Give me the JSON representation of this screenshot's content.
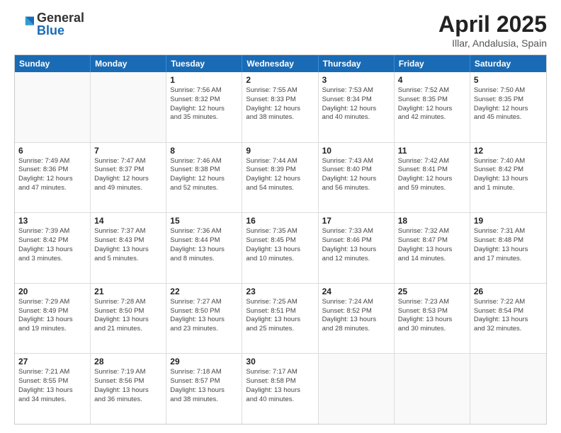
{
  "logo": {
    "general": "General",
    "blue": "Blue"
  },
  "title": {
    "month": "April 2025",
    "location": "Illar, Andalusia, Spain"
  },
  "header_days": [
    "Sunday",
    "Monday",
    "Tuesday",
    "Wednesday",
    "Thursday",
    "Friday",
    "Saturday"
  ],
  "weeks": [
    [
      {
        "day": "",
        "lines": []
      },
      {
        "day": "",
        "lines": []
      },
      {
        "day": "1",
        "lines": [
          "Sunrise: 7:56 AM",
          "Sunset: 8:32 PM",
          "Daylight: 12 hours",
          "and 35 minutes."
        ]
      },
      {
        "day": "2",
        "lines": [
          "Sunrise: 7:55 AM",
          "Sunset: 8:33 PM",
          "Daylight: 12 hours",
          "and 38 minutes."
        ]
      },
      {
        "day": "3",
        "lines": [
          "Sunrise: 7:53 AM",
          "Sunset: 8:34 PM",
          "Daylight: 12 hours",
          "and 40 minutes."
        ]
      },
      {
        "day": "4",
        "lines": [
          "Sunrise: 7:52 AM",
          "Sunset: 8:35 PM",
          "Daylight: 12 hours",
          "and 42 minutes."
        ]
      },
      {
        "day": "5",
        "lines": [
          "Sunrise: 7:50 AM",
          "Sunset: 8:35 PM",
          "Daylight: 12 hours",
          "and 45 minutes."
        ]
      }
    ],
    [
      {
        "day": "6",
        "lines": [
          "Sunrise: 7:49 AM",
          "Sunset: 8:36 PM",
          "Daylight: 12 hours",
          "and 47 minutes."
        ]
      },
      {
        "day": "7",
        "lines": [
          "Sunrise: 7:47 AM",
          "Sunset: 8:37 PM",
          "Daylight: 12 hours",
          "and 49 minutes."
        ]
      },
      {
        "day": "8",
        "lines": [
          "Sunrise: 7:46 AM",
          "Sunset: 8:38 PM",
          "Daylight: 12 hours",
          "and 52 minutes."
        ]
      },
      {
        "day": "9",
        "lines": [
          "Sunrise: 7:44 AM",
          "Sunset: 8:39 PM",
          "Daylight: 12 hours",
          "and 54 minutes."
        ]
      },
      {
        "day": "10",
        "lines": [
          "Sunrise: 7:43 AM",
          "Sunset: 8:40 PM",
          "Daylight: 12 hours",
          "and 56 minutes."
        ]
      },
      {
        "day": "11",
        "lines": [
          "Sunrise: 7:42 AM",
          "Sunset: 8:41 PM",
          "Daylight: 12 hours",
          "and 59 minutes."
        ]
      },
      {
        "day": "12",
        "lines": [
          "Sunrise: 7:40 AM",
          "Sunset: 8:42 PM",
          "Daylight: 13 hours",
          "and 1 minute."
        ]
      }
    ],
    [
      {
        "day": "13",
        "lines": [
          "Sunrise: 7:39 AM",
          "Sunset: 8:42 PM",
          "Daylight: 13 hours",
          "and 3 minutes."
        ]
      },
      {
        "day": "14",
        "lines": [
          "Sunrise: 7:37 AM",
          "Sunset: 8:43 PM",
          "Daylight: 13 hours",
          "and 5 minutes."
        ]
      },
      {
        "day": "15",
        "lines": [
          "Sunrise: 7:36 AM",
          "Sunset: 8:44 PM",
          "Daylight: 13 hours",
          "and 8 minutes."
        ]
      },
      {
        "day": "16",
        "lines": [
          "Sunrise: 7:35 AM",
          "Sunset: 8:45 PM",
          "Daylight: 13 hours",
          "and 10 minutes."
        ]
      },
      {
        "day": "17",
        "lines": [
          "Sunrise: 7:33 AM",
          "Sunset: 8:46 PM",
          "Daylight: 13 hours",
          "and 12 minutes."
        ]
      },
      {
        "day": "18",
        "lines": [
          "Sunrise: 7:32 AM",
          "Sunset: 8:47 PM",
          "Daylight: 13 hours",
          "and 14 minutes."
        ]
      },
      {
        "day": "19",
        "lines": [
          "Sunrise: 7:31 AM",
          "Sunset: 8:48 PM",
          "Daylight: 13 hours",
          "and 17 minutes."
        ]
      }
    ],
    [
      {
        "day": "20",
        "lines": [
          "Sunrise: 7:29 AM",
          "Sunset: 8:49 PM",
          "Daylight: 13 hours",
          "and 19 minutes."
        ]
      },
      {
        "day": "21",
        "lines": [
          "Sunrise: 7:28 AM",
          "Sunset: 8:50 PM",
          "Daylight: 13 hours",
          "and 21 minutes."
        ]
      },
      {
        "day": "22",
        "lines": [
          "Sunrise: 7:27 AM",
          "Sunset: 8:50 PM",
          "Daylight: 13 hours",
          "and 23 minutes."
        ]
      },
      {
        "day": "23",
        "lines": [
          "Sunrise: 7:25 AM",
          "Sunset: 8:51 PM",
          "Daylight: 13 hours",
          "and 25 minutes."
        ]
      },
      {
        "day": "24",
        "lines": [
          "Sunrise: 7:24 AM",
          "Sunset: 8:52 PM",
          "Daylight: 13 hours",
          "and 28 minutes."
        ]
      },
      {
        "day": "25",
        "lines": [
          "Sunrise: 7:23 AM",
          "Sunset: 8:53 PM",
          "Daylight: 13 hours",
          "and 30 minutes."
        ]
      },
      {
        "day": "26",
        "lines": [
          "Sunrise: 7:22 AM",
          "Sunset: 8:54 PM",
          "Daylight: 13 hours",
          "and 32 minutes."
        ]
      }
    ],
    [
      {
        "day": "27",
        "lines": [
          "Sunrise: 7:21 AM",
          "Sunset: 8:55 PM",
          "Daylight: 13 hours",
          "and 34 minutes."
        ]
      },
      {
        "day": "28",
        "lines": [
          "Sunrise: 7:19 AM",
          "Sunset: 8:56 PM",
          "Daylight: 13 hours",
          "and 36 minutes."
        ]
      },
      {
        "day": "29",
        "lines": [
          "Sunrise: 7:18 AM",
          "Sunset: 8:57 PM",
          "Daylight: 13 hours",
          "and 38 minutes."
        ]
      },
      {
        "day": "30",
        "lines": [
          "Sunrise: 7:17 AM",
          "Sunset: 8:58 PM",
          "Daylight: 13 hours",
          "and 40 minutes."
        ]
      },
      {
        "day": "",
        "lines": []
      },
      {
        "day": "",
        "lines": []
      },
      {
        "day": "",
        "lines": []
      }
    ]
  ]
}
